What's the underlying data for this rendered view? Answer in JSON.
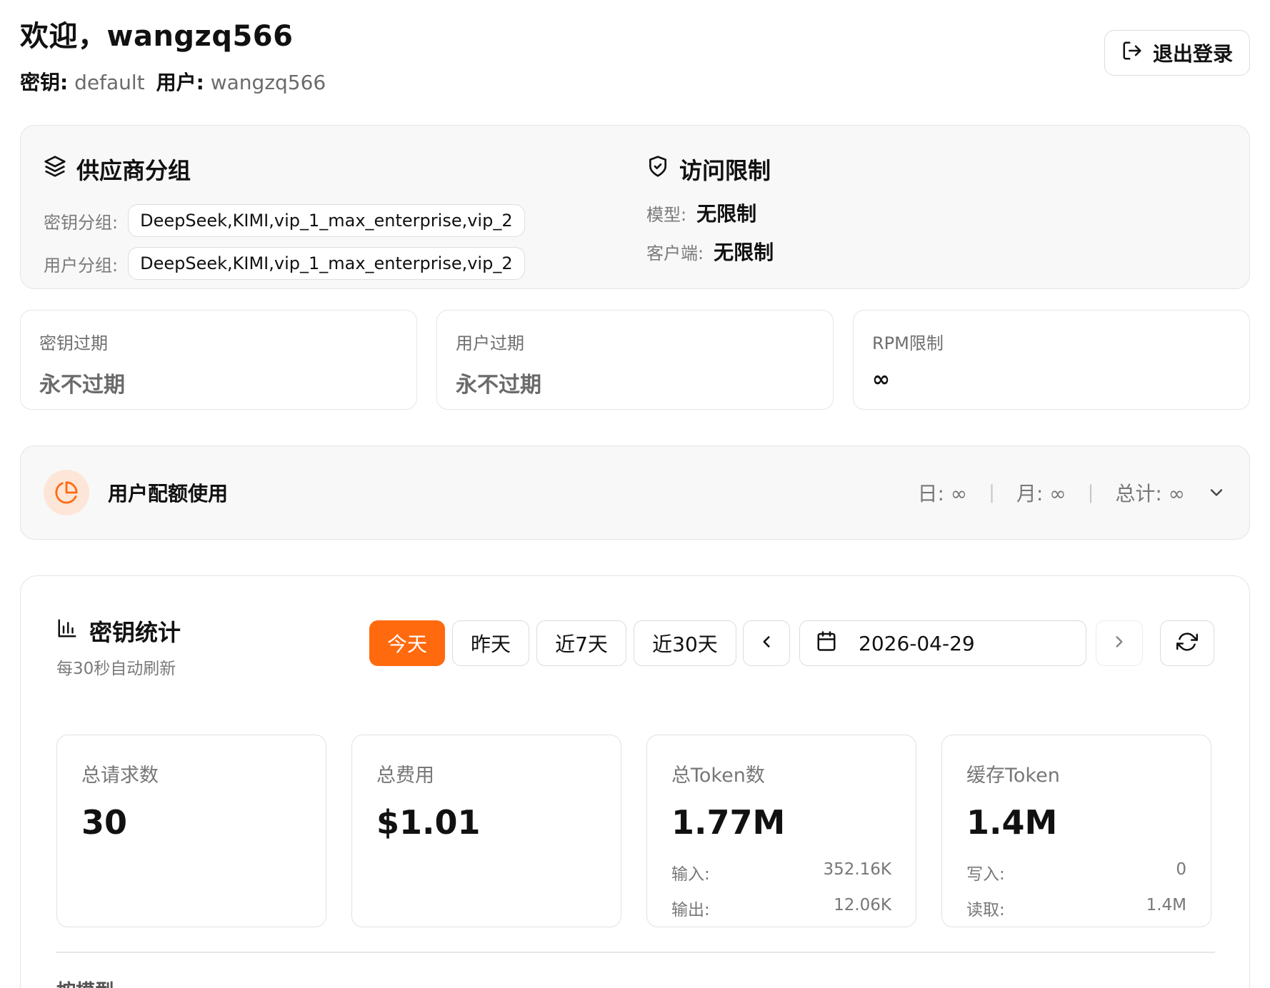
{
  "header": {
    "welcome": "欢迎，wangzq566",
    "key_label": "密钥:",
    "key_value": "default",
    "user_label": "用户:",
    "user_value": "wangzq566",
    "logout_label": "退出登录"
  },
  "provider": {
    "title": "供应商分组",
    "key_group_label": "密钥分组:",
    "key_group_value": "DeepSeek,KIMI,vip_1_max_enterprise,vip_2",
    "user_group_label": "用户分组:",
    "user_group_value": "DeepSeek,KIMI,vip_1_max_enterprise,vip_2"
  },
  "access": {
    "title": "访问限制",
    "model_label": "模型:",
    "model_value": "无限制",
    "client_label": "客户端:",
    "client_value": "无限制"
  },
  "limits": [
    {
      "label": "密钥过期",
      "value": "永不过期"
    },
    {
      "label": "用户过期",
      "value": "永不过期"
    },
    {
      "label": "RPM限制",
      "value": "∞"
    }
  ],
  "quota": {
    "title": "用户配额使用",
    "day_label": "日:",
    "day_value": "∞",
    "month_label": "月:",
    "month_value": "∞",
    "total_label": "总计:",
    "total_value": "∞",
    "separator": "|"
  },
  "stats": {
    "title": "密钥统计",
    "subtitle": "每30秒自动刷新",
    "tabs": [
      "今天",
      "昨天",
      "近7天",
      "近30天"
    ],
    "active_tab": "今天",
    "date": "2026-04-29",
    "metrics": [
      {
        "label": "总请求数",
        "value": "30"
      },
      {
        "label": "总费用",
        "value": "$1.01"
      },
      {
        "label": "总Token数",
        "value": "1.77M",
        "rows": [
          {
            "k": "输入:",
            "v": "352.16K"
          },
          {
            "k": "输出:",
            "v": "12.06K"
          }
        ]
      },
      {
        "label": "缓存Token",
        "value": "1.4M",
        "rows": [
          {
            "k": "写入:",
            "v": "0"
          },
          {
            "k": "读取:",
            "v": "1.4M"
          }
        ]
      }
    ],
    "by_model": "按模型"
  },
  "colors": {
    "accent": "#ff6a0f",
    "accent_soft": "#fde6d8",
    "muted_text": "#777777",
    "card_bg": "#f8f8f8"
  }
}
